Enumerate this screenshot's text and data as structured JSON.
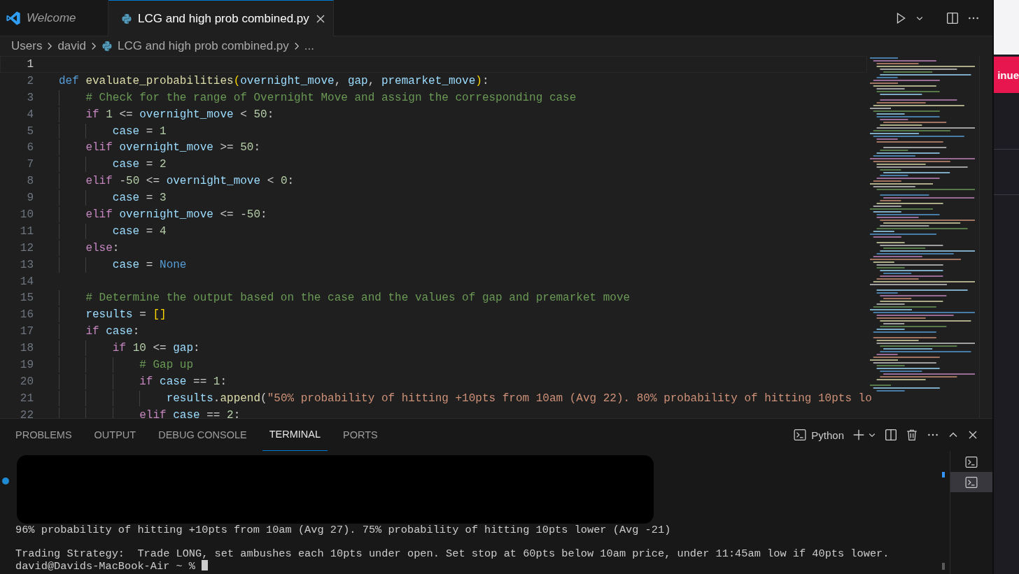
{
  "editor_tabs": [
    {
      "label": "Welcome",
      "kind": "welcome",
      "selected": false,
      "preview": true
    },
    {
      "label": "LCG and high prob combined.py",
      "kind": "python",
      "selected": true,
      "preview": false
    }
  ],
  "breadcrumbs": [
    {
      "label": "Users",
      "kind": "folder"
    },
    {
      "label": "david",
      "kind": "folder"
    },
    {
      "label": "LCG and high prob combined.py",
      "kind": "python"
    },
    {
      "label": "...",
      "kind": "symbol"
    }
  ],
  "code_lines": [
    {
      "number": "1",
      "current": true
    },
    {
      "number": "2",
      "current": false,
      "tokens": [
        {
          "kind": "storage",
          "text": "def "
        },
        {
          "kind": "function",
          "text": "evaluate_probabilities"
        },
        {
          "kind": "bracket",
          "text": "("
        },
        {
          "kind": "variable",
          "text": "overnight_move"
        },
        {
          "kind": "plain",
          "text": ", "
        },
        {
          "kind": "variable",
          "text": "gap"
        },
        {
          "kind": "plain",
          "text": ", "
        },
        {
          "kind": "variable",
          "text": "premarket_move"
        },
        {
          "kind": "bracket",
          "text": ")"
        },
        {
          "kind": "plain",
          "text": ":"
        }
      ]
    },
    {
      "number": "3",
      "current": false,
      "tokens": [
        {
          "kind": "comment",
          "text": "    # Check for the range of Overnight Move and assign the corresponding case"
        }
      ]
    },
    {
      "number": "4",
      "current": false,
      "tokens": [
        {
          "kind": "control",
          "text": "    if "
        },
        {
          "kind": "number",
          "text": "1"
        },
        {
          "kind": "plain",
          "text": " <= "
        },
        {
          "kind": "variable",
          "text": "overnight_move"
        },
        {
          "kind": "plain",
          "text": " < "
        },
        {
          "kind": "number",
          "text": "50"
        },
        {
          "kind": "plain",
          "text": ":"
        }
      ]
    },
    {
      "number": "5",
      "current": false,
      "tokens": [
        {
          "kind": "variable",
          "text": "        case"
        },
        {
          "kind": "plain",
          "text": " = "
        },
        {
          "kind": "number",
          "text": "1"
        }
      ]
    },
    {
      "number": "6",
      "current": false,
      "tokens": [
        {
          "kind": "control",
          "text": "    elif "
        },
        {
          "kind": "variable",
          "text": "overnight_move"
        },
        {
          "kind": "plain",
          "text": " >= "
        },
        {
          "kind": "number",
          "text": "50"
        },
        {
          "kind": "plain",
          "text": ":"
        }
      ]
    },
    {
      "number": "7",
      "current": false,
      "tokens": [
        {
          "kind": "variable",
          "text": "        case"
        },
        {
          "kind": "plain",
          "text": " = "
        },
        {
          "kind": "number",
          "text": "2"
        }
      ]
    },
    {
      "number": "8",
      "current": false,
      "tokens": [
        {
          "kind": "control",
          "text": "    elif "
        },
        {
          "kind": "plain",
          "text": "-"
        },
        {
          "kind": "number",
          "text": "50"
        },
        {
          "kind": "plain",
          "text": " <= "
        },
        {
          "kind": "variable",
          "text": "overnight_move"
        },
        {
          "kind": "plain",
          "text": " < "
        },
        {
          "kind": "number",
          "text": "0"
        },
        {
          "kind": "plain",
          "text": ":"
        }
      ]
    },
    {
      "number": "9",
      "current": false,
      "tokens": [
        {
          "kind": "variable",
          "text": "        case"
        },
        {
          "kind": "plain",
          "text": " = "
        },
        {
          "kind": "number",
          "text": "3"
        }
      ]
    },
    {
      "number": "10",
      "current": false,
      "tokens": [
        {
          "kind": "control",
          "text": "    elif "
        },
        {
          "kind": "variable",
          "text": "overnight_move"
        },
        {
          "kind": "plain",
          "text": " <= -"
        },
        {
          "kind": "number",
          "text": "50"
        },
        {
          "kind": "plain",
          "text": ":"
        }
      ]
    },
    {
      "number": "11",
      "current": false,
      "tokens": [
        {
          "kind": "variable",
          "text": "        case"
        },
        {
          "kind": "plain",
          "text": " = "
        },
        {
          "kind": "number",
          "text": "4"
        }
      ]
    },
    {
      "number": "12",
      "current": false,
      "tokens": [
        {
          "kind": "control",
          "text": "    else"
        },
        {
          "kind": "plain",
          "text": ":"
        }
      ]
    },
    {
      "number": "13",
      "current": false,
      "tokens": [
        {
          "kind": "variable",
          "text": "        case"
        },
        {
          "kind": "plain",
          "text": " = "
        },
        {
          "kind": "constant",
          "text": "None"
        }
      ]
    },
    {
      "number": "14",
      "current": false
    },
    {
      "number": "15",
      "current": false,
      "tokens": [
        {
          "kind": "comment",
          "text": "    # Determine the output based on the case and the values of gap and premarket move"
        }
      ]
    },
    {
      "number": "16",
      "current": false,
      "tokens": [
        {
          "kind": "variable",
          "text": "    results"
        },
        {
          "kind": "plain",
          "text": " = "
        },
        {
          "kind": "bracket",
          "text": "[]"
        }
      ]
    },
    {
      "number": "17",
      "current": false,
      "tokens": [
        {
          "kind": "control",
          "text": "    if "
        },
        {
          "kind": "variable",
          "text": "case"
        },
        {
          "kind": "plain",
          "text": ":"
        }
      ]
    },
    {
      "number": "18",
      "current": false,
      "tokens": [
        {
          "kind": "control",
          "text": "        if "
        },
        {
          "kind": "number",
          "text": "10"
        },
        {
          "kind": "plain",
          "text": " <= "
        },
        {
          "kind": "variable",
          "text": "gap"
        },
        {
          "kind": "plain",
          "text": ":"
        }
      ]
    },
    {
      "number": "19",
      "current": false,
      "tokens": [
        {
          "kind": "comment",
          "text": "            # Gap up"
        }
      ]
    },
    {
      "number": "20",
      "current": false,
      "tokens": [
        {
          "kind": "control",
          "text": "            if "
        },
        {
          "kind": "variable",
          "text": "case"
        },
        {
          "kind": "plain",
          "text": " == "
        },
        {
          "kind": "number",
          "text": "1"
        },
        {
          "kind": "plain",
          "text": ":"
        }
      ]
    },
    {
      "number": "21",
      "current": false,
      "tokens": [
        {
          "kind": "variable",
          "text": "                results"
        },
        {
          "kind": "plain",
          "text": "."
        },
        {
          "kind": "function",
          "text": "append"
        },
        {
          "kind": "plain",
          "text": "("
        },
        {
          "kind": "string",
          "text": "\"50% probability of hitting +10pts from 10am (Avg 22). 80% probability of hitting 10pts lo"
        }
      ]
    },
    {
      "number": "22",
      "current": false,
      "tokens": [
        {
          "kind": "control",
          "text": "            elif "
        },
        {
          "kind": "variable",
          "text": "case"
        },
        {
          "kind": "plain",
          "text": " == "
        },
        {
          "kind": "number",
          "text": "2"
        },
        {
          "kind": "plain",
          "text": ":"
        }
      ]
    }
  ],
  "panel": {
    "tabs": [
      {
        "label": "PROBLEMS",
        "selected": false
      },
      {
        "label": "OUTPUT",
        "selected": false
      },
      {
        "label": "DEBUG CONSOLE",
        "selected": false
      },
      {
        "label": "TERMINAL",
        "selected": true
      },
      {
        "label": "PORTS",
        "selected": false
      }
    ],
    "terminal_profile": "Python",
    "terminals": [
      {
        "selected": false
      },
      {
        "selected": true
      }
    ],
    "output_groups": [
      [
        {
          "text": "96% probability of hitting +10pts from 10am (Avg 27). 75% probability of hitting 10pts lower (Avg -21)",
          "kind": "output"
        }
      ],
      [
        {
          "text": "Trading Strategy:  Trade LONG, set ambushes each 10pts under open. Set stop at 60pts below 10am price, under 11:45am low if 40pts lower.",
          "kind": "output"
        },
        {
          "text": "david@Davids-MacBook-Air ~ %",
          "kind": "prompt"
        }
      ]
    ]
  },
  "background_window": {
    "button_label": "inue"
  }
}
